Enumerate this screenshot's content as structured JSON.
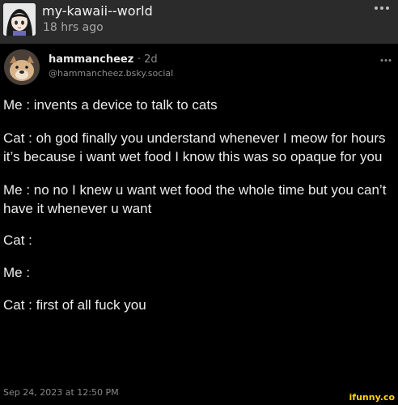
{
  "repost_header": {
    "username": "my-kawaii--world",
    "time": "18 hrs ago"
  },
  "post": {
    "display_name": "hammancheez",
    "age": "· 2d",
    "handle": "@hammancheez.bsky.social",
    "paragraphs": [
      "Me : invents a device to talk to cats",
      "Cat : oh god finally you understand whenever I meow for hours it’s because i want wet food I know this was so opaque for you",
      "Me : no no I knew u want wet food the whole time but you can’t have it whenever u want",
      "Cat :",
      "Me :",
      "Cat : first of all fuck you"
    ],
    "date": "Sep 24, 2023 at 12:50 PM"
  },
  "watermark": "ifunny.co",
  "icons": {
    "header_more": "more-horizontal-icon",
    "post_more": "more-horizontal-icon"
  },
  "colors": {
    "header_bg": "#2b2b2b",
    "post_bg": "#000000",
    "text": "#ececec",
    "muted": "#8a8a8a",
    "watermark": "#ffd400"
  }
}
